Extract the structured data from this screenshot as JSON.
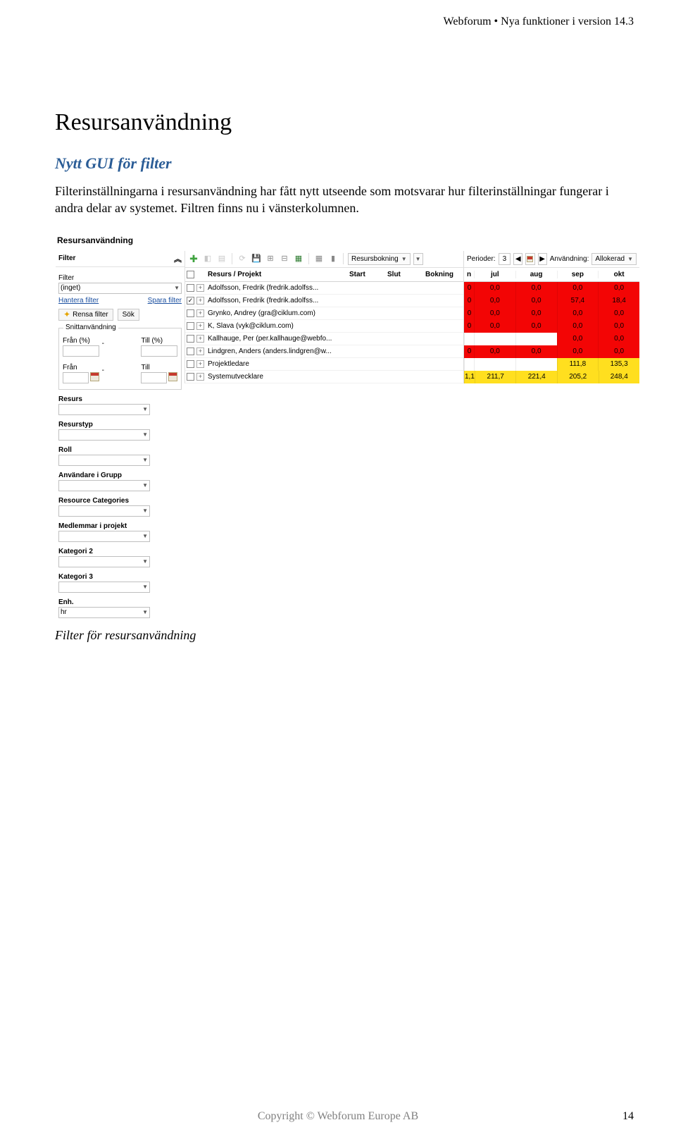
{
  "header": {
    "text": "Webforum • Nya funktioner i version 14.3"
  },
  "page": {
    "h1": "Resursanvändning",
    "h2": "Nytt GUI för filter",
    "body": "Filterinställningarna i resursanvändning har fått nytt utseende som motsvarar hur filterinställningar fungerar i andra delar av systemet. Filtren finns nu i vänsterkolumnen.",
    "caption": "Filter för resursanvändning"
  },
  "shot": {
    "title": "Resursanvändning",
    "filterPanel": {
      "header": "Filter",
      "filter_label": "Filter",
      "filter_value": "(inget)",
      "manage_link": "Hantera filter",
      "save_link": "Spara filter",
      "clear_btn": "Rensa filter",
      "search_btn": "Sök",
      "snitt_legend": "Snittanvändning",
      "from_pct": "Från (%)",
      "to_pct": "Till (%)",
      "from": "Från",
      "to": "Till",
      "sections": [
        "Resurs",
        "Resurstyp",
        "Roll",
        "Användare i Grupp",
        "Resource Categories",
        "Medlemmar i projekt",
        "Kategori 2",
        "Kategori 3"
      ],
      "enh_label": "Enh.",
      "enh_value": "hr"
    },
    "content": {
      "columns": {
        "name": "Resurs / Projekt",
        "start": "Start",
        "slut": "Slut",
        "bokning": "Bokning"
      },
      "rows": [
        {
          "checked": false,
          "label": "Adolfsson, Fredrik (fredrik.adolfss..."
        },
        {
          "checked": true,
          "label": "Adolfsson, Fredrik (fredrik.adolfss..."
        },
        {
          "checked": false,
          "label": "Grynko, Andrey (gra@ciklum.com)"
        },
        {
          "checked": false,
          "label": "K, Slava (vyk@ciklum.com)"
        },
        {
          "checked": false,
          "label": "Kallhauge, Per (per.kallhauge@webfo..."
        },
        {
          "checked": false,
          "label": "Lindgren, Anders (anders.lindgren@w..."
        },
        {
          "checked": false,
          "label": "Projektledare"
        },
        {
          "checked": false,
          "label": "Systemutvecklare"
        }
      ],
      "toolbar": {
        "resursbokning": "Resursbokning"
      }
    },
    "right": {
      "perioder_label": "Perioder:",
      "perioder_value": "3",
      "anvandning_label": "Användning:",
      "anvandning_value": "Allokerad",
      "months": [
        "n",
        "jul",
        "aug",
        "sep",
        "okt"
      ],
      "cells": [
        {
          "c": [
            "0",
            "0,0",
            "0,0",
            "0,0",
            "0,0"
          ],
          "cls": [
            "red",
            "red",
            "red",
            "red",
            "red"
          ]
        },
        {
          "c": [
            "0",
            "0,0",
            "0,0",
            "57,4",
            "18,4"
          ],
          "cls": [
            "red",
            "red",
            "red",
            "red",
            "red"
          ]
        },
        {
          "c": [
            "0",
            "0,0",
            "0,0",
            "0,0",
            "0,0"
          ],
          "cls": [
            "red",
            "red",
            "red",
            "red",
            "red"
          ]
        },
        {
          "c": [
            "0",
            "0,0",
            "0,0",
            "0,0",
            "0,0"
          ],
          "cls": [
            "red",
            "red",
            "red",
            "red",
            "red"
          ]
        },
        {
          "c": [
            "",
            "",
            "",
            "0,0",
            "0,0"
          ],
          "cls": [
            "white",
            "white",
            "white",
            "red",
            "red"
          ]
        },
        {
          "c": [
            "0",
            "0,0",
            "0,0",
            "0,0",
            "0,0"
          ],
          "cls": [
            "red",
            "red",
            "red",
            "red",
            "red"
          ]
        },
        {
          "c": [
            "",
            "",
            "",
            "111,8",
            "135,3"
          ],
          "cls": [
            "white",
            "white",
            "white",
            "yellow",
            "yellow"
          ]
        },
        {
          "c": [
            "1,1",
            "211,7",
            "221,4",
            "205,2",
            "248,4"
          ],
          "cls": [
            "yellow",
            "yellow",
            "yellow",
            "yellow",
            "yellow"
          ]
        }
      ]
    }
  },
  "footer": {
    "text": "Copyright © Webforum Europe AB",
    "page": "14"
  }
}
